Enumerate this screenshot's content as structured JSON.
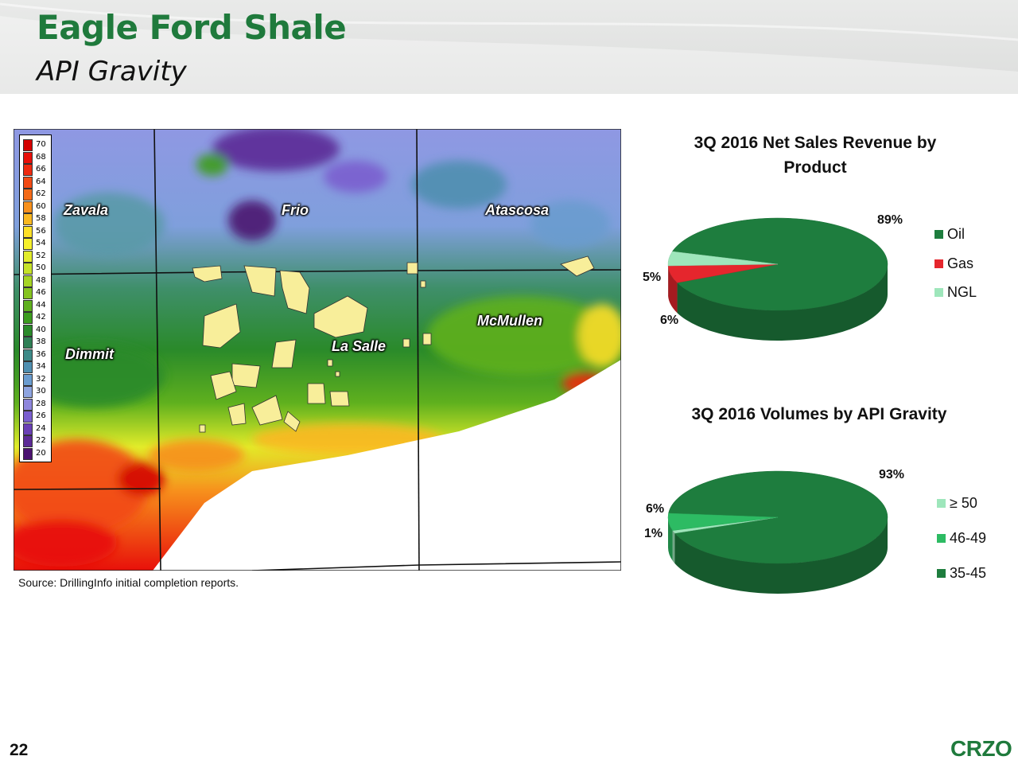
{
  "header": {
    "title": "Eagle Ford Shale",
    "subtitle": "API Gravity"
  },
  "map": {
    "legend_values": [
      "70",
      "68",
      "66",
      "64",
      "62",
      "60",
      "58",
      "56",
      "54",
      "52",
      "50",
      "48",
      "46",
      "44",
      "42",
      "40",
      "38",
      "36",
      "34",
      "32",
      "30",
      "28",
      "26",
      "24",
      "22",
      "20"
    ],
    "legend_colors": [
      "#d40000",
      "#e8100a",
      "#ee2a10",
      "#f24a14",
      "#f46a18",
      "#f7901c",
      "#fab820",
      "#fde028",
      "#f6f02c",
      "#e2ec2a",
      "#c6e228",
      "#a6d424",
      "#86c420",
      "#5fb01e",
      "#3c9c1e",
      "#2a8a2a",
      "#2f7f55",
      "#3d8a88",
      "#4f8fb0",
      "#6a9ccf",
      "#8ea4e0",
      "#8e86dc",
      "#7a5fcf",
      "#6a40b5",
      "#5c2a96",
      "#4b1270"
    ],
    "counties": [
      "Zavala",
      "Frio",
      "Atascosa",
      "McMullen",
      "La Salle",
      "Dimmit"
    ]
  },
  "source": "Source:  DrillingInfo initial completion reports.",
  "charts": [
    {
      "title_line1": "3Q 2016 Net Sales Revenue by",
      "title_line2": "Product",
      "chart_data": {
        "type": "pie",
        "title": "3Q 2016 Net Sales Revenue by Product",
        "categories": [
          "Oil",
          "Gas",
          "NGL"
        ],
        "values": [
          89,
          6,
          5
        ],
        "data_labels": [
          "89%",
          "6%",
          "5%"
        ],
        "colors": [
          "#1e7d3e",
          "#e5262d",
          "#9ee6bb"
        ],
        "legend_position": "right"
      }
    },
    {
      "title_line1": "3Q 2016 Volumes by API Gravity",
      "title_line2": "",
      "chart_data": {
        "type": "pie",
        "title": "3Q 2016 Volumes by API Gravity",
        "categories": [
          "≥ 50",
          "46-49",
          "35-45"
        ],
        "values": [
          1,
          6,
          93
        ],
        "data_labels": [
          "1%",
          "6%",
          "93%"
        ],
        "colors": [
          "#9ee6bb",
          "#2dbb63",
          "#1e7d3e"
        ],
        "legend_position": "right"
      }
    }
  ],
  "footer": {
    "page_number": "22",
    "brand": "CRZO"
  }
}
